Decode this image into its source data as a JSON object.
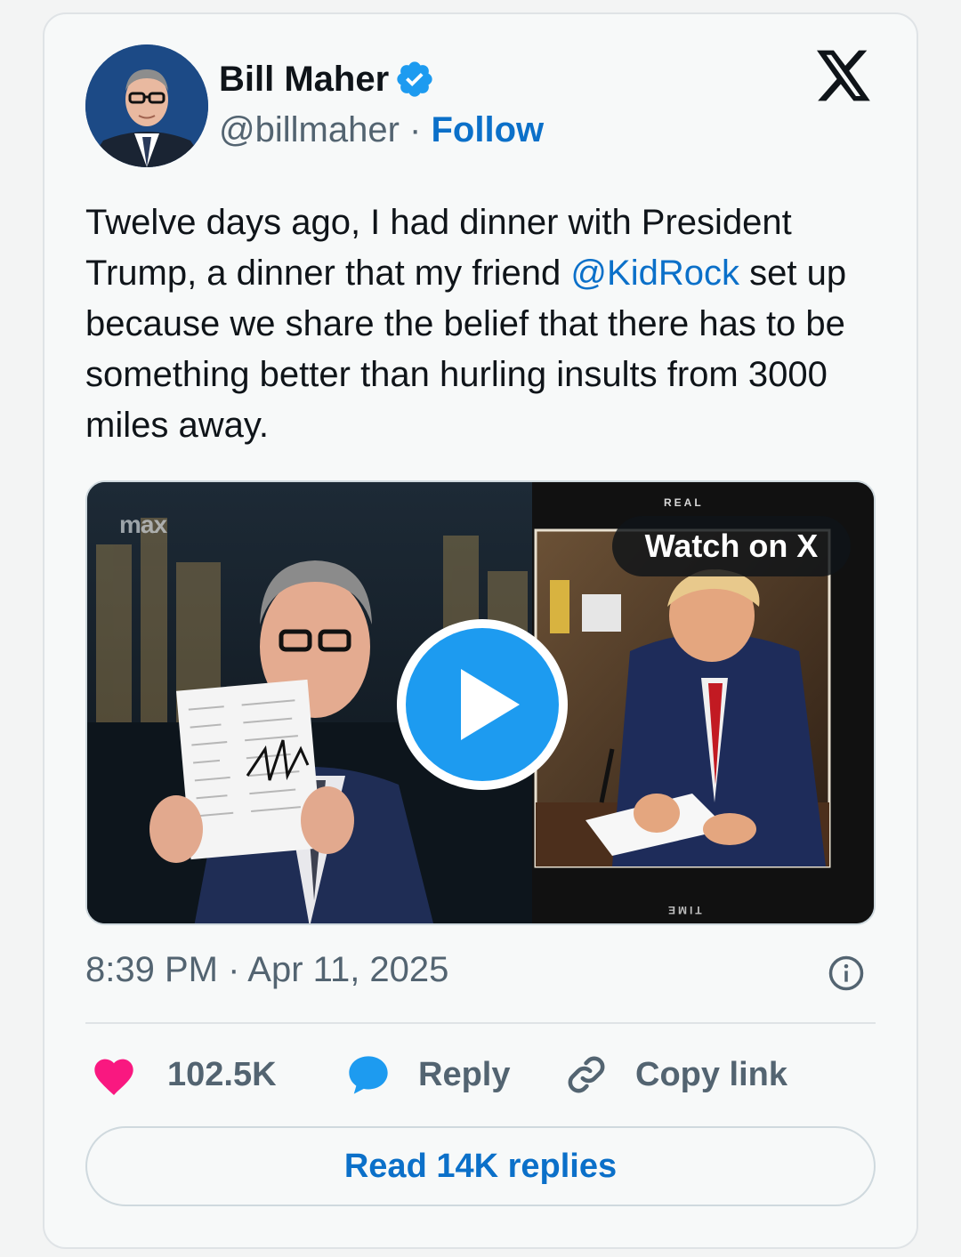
{
  "author": {
    "name": "Bill Maher",
    "handle": "@billmaher",
    "separator": "·",
    "follow_label": "Follow",
    "verified": true
  },
  "platform_icon": "x-logo-icon",
  "tweet": {
    "text_before": "Twelve days ago, I had dinner with President Trump, a dinner that my friend ",
    "mention": "@KidRock",
    "text_after": " set up because we share the belief that there has to be something better than hurling insults from 3000 miles away."
  },
  "media": {
    "watch_label": "Watch on X",
    "overlay_logo": "max",
    "magazine_label": "REAL",
    "magazine_bottom": "TIME",
    "play_icon": "play-icon"
  },
  "timestamp": "8:39 PM · Apr 11, 2025",
  "actions": {
    "like_count": "102.5K",
    "reply_label": "Reply",
    "copy_label": "Copy link"
  },
  "read_replies_label": "Read 14K replies",
  "colors": {
    "link": "#0b70c9",
    "heart": "#f91880",
    "reply_icon": "#1d9bf0",
    "play": "#1d9bf0",
    "muted": "#536471"
  }
}
